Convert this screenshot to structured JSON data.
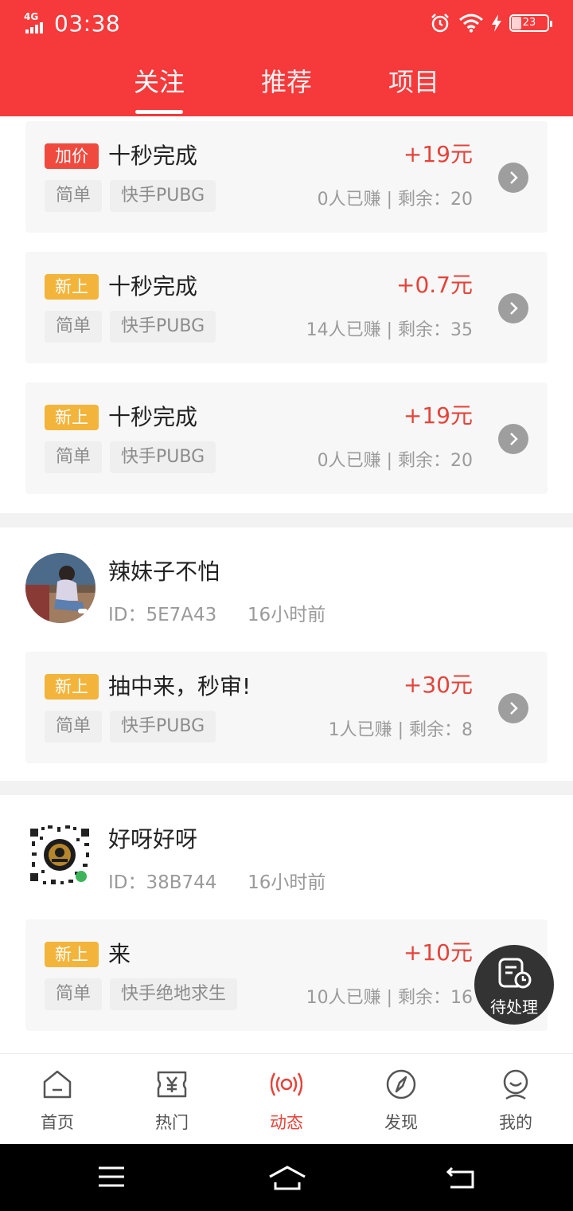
{
  "status_bar": {
    "network": "4G",
    "time": "03:38",
    "battery": "23"
  },
  "tabs": [
    {
      "label": "关注",
      "active": true
    },
    {
      "label": "推荐",
      "active": false
    },
    {
      "label": "项目",
      "active": false
    }
  ],
  "tasks_top": [
    {
      "badge": "加价",
      "title": "十秒完成",
      "tags": [
        "简单",
        "快手PUBG"
      ],
      "price": "+19元",
      "earned": "0人已赚",
      "remaining": "剩余：20"
    },
    {
      "badge": "新上",
      "title": "十秒完成",
      "tags": [
        "简单",
        "快手PUBG"
      ],
      "price": "+0.7元",
      "earned": "14人已赚",
      "remaining": "剩余：35"
    },
    {
      "badge": "新上",
      "title": "十秒完成",
      "tags": [
        "简单",
        "快手PUBG"
      ],
      "price": "+19元",
      "earned": "0人已赚",
      "remaining": "剩余：20"
    }
  ],
  "posts": [
    {
      "user": {
        "name": "辣妹子不怕",
        "id": "ID：5E7A43",
        "time": "16小时前"
      },
      "task": {
        "badge": "新上",
        "title": "抽中来，秒审!",
        "tags": [
          "简单",
          "快手PUBG"
        ],
        "price": "+30元",
        "earned": "1人已赚",
        "remaining": "剩余：8"
      }
    },
    {
      "user": {
        "name": "好呀好呀",
        "id": "ID：38B744",
        "time": "16小时前"
      },
      "task": {
        "badge": "新上",
        "title": "来",
        "tags": [
          "简单",
          "快手绝地求生"
        ],
        "price": "+10元",
        "earned": "10人已赚",
        "remaining": "剩余：16"
      }
    }
  ],
  "meta_separator": "|",
  "fab": {
    "label": "待处理"
  },
  "nav": [
    {
      "label": "首页",
      "icon": "home-icon",
      "active": false
    },
    {
      "label": "热门",
      "icon": "yen-ticket-icon",
      "active": false
    },
    {
      "label": "动态",
      "icon": "broadcast-icon",
      "active": true
    },
    {
      "label": "发现",
      "icon": "compass-icon",
      "active": false
    },
    {
      "label": "我的",
      "icon": "profile-icon",
      "active": false
    }
  ],
  "colors": {
    "brand": "#f6393a",
    "price": "#e5433a",
    "badge_new": "#f3b43b",
    "badge_raise": "#f04a3f"
  }
}
